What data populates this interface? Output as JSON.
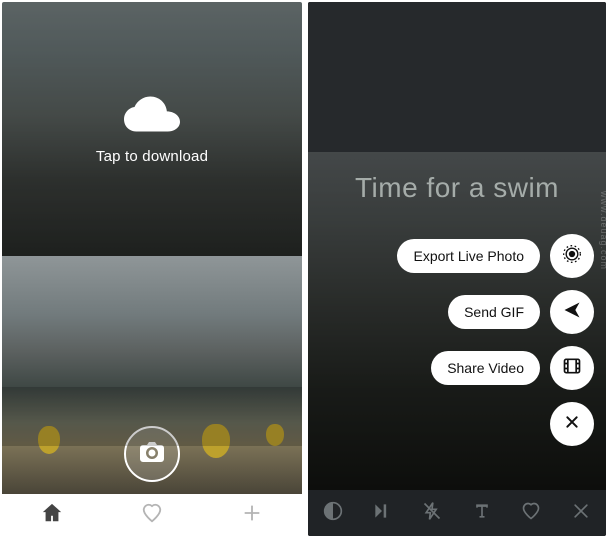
{
  "left": {
    "download_prompt": "Tap to download",
    "nav": {
      "home": "home",
      "heart": "heart",
      "plus": "plus"
    }
  },
  "right": {
    "caption": "Time for a swim",
    "actions": {
      "export": "Export Live Photo",
      "gif": "Send GIF",
      "video": "Share Video"
    },
    "bottom_nav": {
      "contrast": "contrast",
      "skip": "skip",
      "flash_off": "flash-off",
      "text": "text",
      "heart": "heart",
      "close": "close"
    }
  },
  "watermark": "www.deuag.com"
}
